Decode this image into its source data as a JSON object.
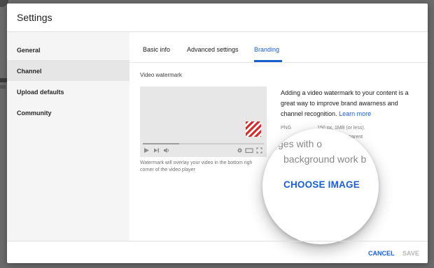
{
  "dialog": {
    "title": "Settings"
  },
  "sidebar": {
    "items": [
      {
        "label": "General"
      },
      {
        "label": "Channel"
      },
      {
        "label": "Upload defaults"
      },
      {
        "label": "Community"
      }
    ]
  },
  "tabs": [
    {
      "label": "Basic info"
    },
    {
      "label": "Advanced settings"
    },
    {
      "label": "Branding"
    }
  ],
  "branding": {
    "section_label": "Video watermark",
    "helper_line1": "Watermark will overlay your video in the bottom righ",
    "helper_line2": "corner of the video player",
    "description": "Adding a video watermark to your content is a great way to improve brand awarness and channel recognition.",
    "learn_more": "Learn more",
    "requirements_line1": "PNG                   150 px, 1MB (or less).",
    "requirements_line2": "                                  nd a transparent",
    "magnified_line1": "ges with o",
    "magnified_line2": "background work b",
    "choose_image": "CHOOSE IMAGE"
  },
  "footer": {
    "cancel": "CANCEL",
    "save": "SAVE"
  },
  "colors": {
    "accent": "#1a5fce",
    "disabled": "#b5b5b5",
    "watermark": "#d42d2d"
  }
}
